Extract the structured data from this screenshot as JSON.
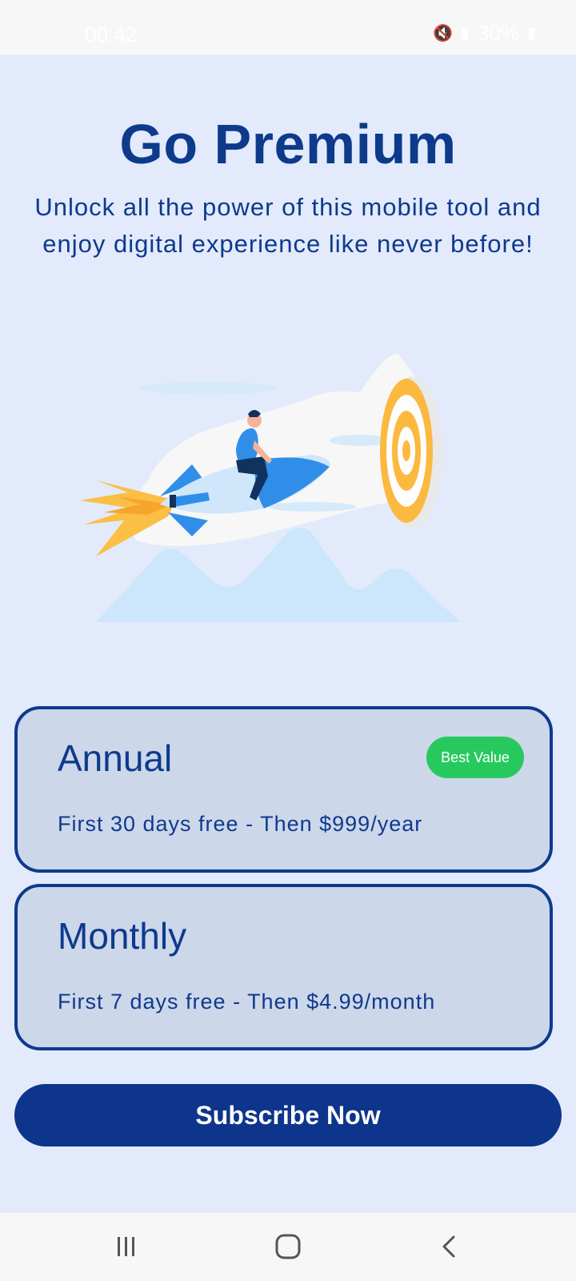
{
  "status_bar": {
    "time": "00:42",
    "battery": "30%",
    "icons": [
      "mute-icon",
      "volte-icon",
      "4g-icon",
      "signal-icon",
      "battery-icon"
    ]
  },
  "header": {
    "title": "Go Premium",
    "subtitle": "Unlock all the power of this mobile tool and enjoy digital experience like never before!"
  },
  "illustration": {
    "icon": "rocket-target-illustration"
  },
  "plans": [
    {
      "name": "Annual",
      "description": "First 30 days free - Then $999/year",
      "badge": "Best Value"
    },
    {
      "name": "Monthly",
      "description": "First 7 days free - Then $4.99/month"
    }
  ],
  "cta": {
    "label": "Subscribe Now"
  },
  "nav_bar": {
    "icons": [
      "recent-apps-icon",
      "home-icon",
      "back-icon"
    ]
  },
  "colors": {
    "background": "#e2eafb",
    "primary": "#0e3a8c",
    "card": "#cdd7ea",
    "badge": "#27c95f",
    "bars": "#f7f7f7"
  }
}
